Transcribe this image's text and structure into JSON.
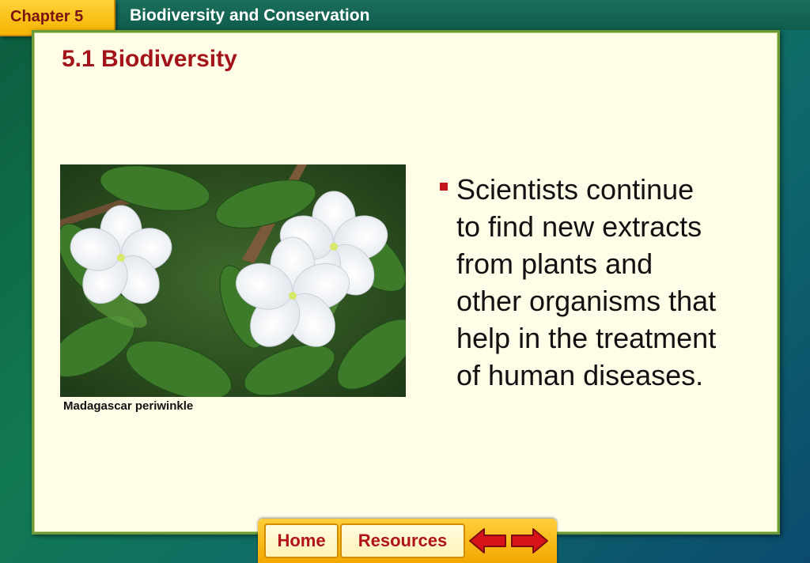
{
  "header": {
    "chapter_tab": "Chapter 5",
    "title": "Biodiversity and Conservation"
  },
  "slide": {
    "section_title": "5.1 Biodiversity",
    "image_caption": "Madagascar periwinkle",
    "bullet_text": "Scientists continue\nto find new extracts\nfrom plants and\nother organisms that\nhelp in the treatment\nof human diseases."
  },
  "nav": {
    "home_label": "Home",
    "resources_label": "Resources",
    "back_icon": "left-arrow-icon",
    "forward_icon": "right-arrow-icon"
  },
  "colors": {
    "accent_red": "#a3141a",
    "tab_gold": "#f5b400",
    "panel_bg": "#fffce7",
    "border_green": "#6a9a3a"
  }
}
